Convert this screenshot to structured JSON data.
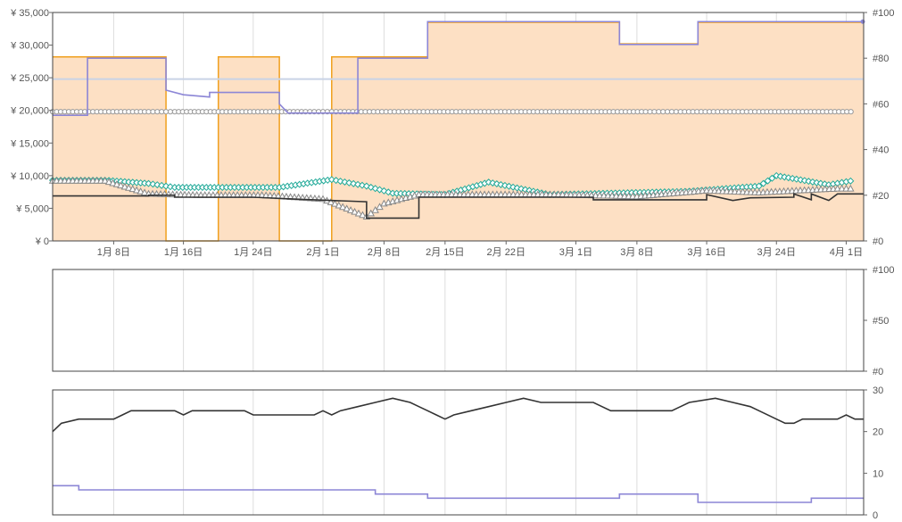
{
  "chart_data": [
    {
      "type": "line",
      "title": "",
      "x_axis": {
        "start": "2024-01-01",
        "end": "2024-04-03",
        "ticks": [
          {
            "label": "1月 8日",
            "date": "2024-01-08"
          },
          {
            "label": "1月 16日",
            "date": "2024-01-16"
          },
          {
            "label": "1月 24日",
            "date": "2024-01-24"
          },
          {
            "label": "2月 1日",
            "date": "2024-02-01"
          },
          {
            "label": "2月 8日",
            "date": "2024-02-08"
          },
          {
            "label": "2月 15日",
            "date": "2024-02-15"
          },
          {
            "label": "2月 22日",
            "date": "2024-02-22"
          },
          {
            "label": "3月 1日",
            "date": "2024-03-01"
          },
          {
            "label": "3月 8日",
            "date": "2024-03-08"
          },
          {
            "label": "3月 16日",
            "date": "2024-03-16"
          },
          {
            "label": "3月 24日",
            "date": "2024-03-24"
          },
          {
            "label": "4月 1日",
            "date": "2024-04-01"
          }
        ]
      },
      "left_axis": {
        "ylim": [
          0,
          35000
        ],
        "ticks": [
          0,
          5000,
          10000,
          15000,
          20000,
          25000,
          30000,
          35000
        ],
        "tick_labels": [
          "¥ 0",
          "¥ 5,000",
          "¥ 10,000",
          "¥ 15,000",
          "¥ 20,000",
          "¥ 25,000",
          "¥ 30,000",
          "¥ 35,000"
        ]
      },
      "right_axis": {
        "ylim": [
          0,
          100
        ],
        "ticks": [
          0,
          20,
          40,
          60,
          80,
          100
        ],
        "tick_labels": [
          "#0",
          "#20",
          "#40",
          "#60",
          "#80",
          "#100"
        ]
      },
      "reference_line": {
        "value": 24800,
        "color": "#c9d3e6"
      },
      "series": [
        {
          "kind": "area",
          "color": "#f0a01e",
          "fill": "#fde0c4",
          "points": [
            [
              "2024-01-01",
              28200
            ],
            [
              "2024-01-14",
              28200
            ],
            [
              "2024-01-14",
              0
            ],
            [
              "2024-01-20",
              0
            ],
            [
              "2024-01-20",
              28200
            ],
            [
              "2024-01-27",
              28200
            ],
            [
              "2024-01-27",
              0
            ],
            [
              "2024-02-02",
              0
            ],
            [
              "2024-02-02",
              28200
            ],
            [
              "2024-02-13",
              28200
            ],
            [
              "2024-02-13",
              33500
            ],
            [
              "2024-03-06",
              33500
            ],
            [
              "2024-03-06",
              30200
            ],
            [
              "2024-03-15",
              30200
            ],
            [
              "2024-03-15",
              33500
            ],
            [
              "2024-04-03",
              33500
            ]
          ]
        },
        {
          "kind": "line",
          "axis": "right",
          "color": "#8c86d6",
          "points": [
            [
              "2024-01-01",
              55
            ],
            [
              "2024-01-05",
              55
            ],
            [
              "2024-01-05",
              80
            ],
            [
              "2024-01-14",
              80
            ],
            [
              "2024-01-14",
              66
            ],
            [
              "2024-01-16",
              64
            ],
            [
              "2024-01-19",
              63
            ],
            [
              "2024-01-19",
              65
            ],
            [
              "2024-01-27",
              65
            ],
            [
              "2024-01-27",
              60
            ],
            [
              "2024-01-28",
              56
            ],
            [
              "2024-02-05",
              56
            ],
            [
              "2024-02-05",
              80
            ],
            [
              "2024-02-13",
              80
            ],
            [
              "2024-02-13",
              96
            ],
            [
              "2024-03-06",
              96
            ],
            [
              "2024-03-06",
              86
            ],
            [
              "2024-03-15",
              86
            ],
            [
              "2024-03-15",
              96
            ],
            [
              "2024-04-03",
              96
            ]
          ]
        },
        {
          "kind": "line",
          "color": "#333333",
          "points": [
            [
              "2024-01-01",
              6900
            ],
            [
              "2024-01-12",
              6900
            ],
            [
              "2024-01-12",
              7000
            ],
            [
              "2024-01-15",
              7000
            ],
            [
              "2024-01-15",
              6700
            ],
            [
              "2024-01-24",
              6700
            ],
            [
              "2024-01-29",
              6400
            ],
            [
              "2024-02-06",
              6000
            ],
            [
              "2024-02-06",
              3500
            ],
            [
              "2024-02-12",
              3500
            ],
            [
              "2024-02-12",
              6700
            ],
            [
              "2024-03-03",
              6700
            ],
            [
              "2024-03-03",
              6300
            ],
            [
              "2024-03-16",
              6300
            ],
            [
              "2024-03-16",
              7100
            ],
            [
              "2024-03-19",
              6200
            ],
            [
              "2024-03-21",
              6600
            ],
            [
              "2024-03-26",
              6700
            ],
            [
              "2024-03-26",
              7200
            ],
            [
              "2024-03-28",
              6300
            ],
            [
              "2024-03-28",
              7200
            ],
            [
              "2024-03-30",
              6200
            ],
            [
              "2024-03-31",
              7200
            ],
            [
              "2024-04-03",
              7200
            ]
          ]
        },
        {
          "kind": "markers",
          "shape": "circle",
          "color": "#999999",
          "points": [
            [
              "2024-01-01",
              19800
            ],
            [
              "2024-01-07",
              19800
            ],
            [
              "2024-01-12",
              19800
            ],
            [
              "2024-01-15",
              19800
            ],
            [
              "2024-01-20",
              19800
            ],
            [
              "2024-01-25",
              19800
            ],
            [
              "2024-01-30",
              19800
            ],
            [
              "2024-02-03",
              19800
            ],
            [
              "2024-02-13",
              19800
            ],
            [
              "2024-02-20",
              19800
            ],
            [
              "2024-02-27",
              19800
            ],
            [
              "2024-03-03",
              19800
            ],
            [
              "2024-03-09",
              19800
            ],
            [
              "2024-03-13",
              19800
            ],
            [
              "2024-03-22",
              19800
            ],
            [
              "2024-03-27",
              19800
            ],
            [
              "2024-04-02",
              19800
            ]
          ]
        },
        {
          "kind": "markers",
          "shape": "diamond",
          "color": "#22aa99",
          "points": [
            [
              "2024-01-01",
              9300
            ],
            [
              "2024-01-07",
              9300
            ],
            [
              "2024-01-12",
              8800
            ],
            [
              "2024-01-15",
              8200
            ],
            [
              "2024-01-20",
              8200
            ],
            [
              "2024-01-27",
              8200
            ],
            [
              "2024-02-02",
              9400
            ],
            [
              "2024-02-06",
              8400
            ],
            [
              "2024-02-09",
              7300
            ],
            [
              "2024-02-15",
              7100
            ],
            [
              "2024-02-20",
              9000
            ],
            [
              "2024-02-27",
              7100
            ],
            [
              "2024-03-14",
              7600
            ],
            [
              "2024-03-22",
              8400
            ],
            [
              "2024-03-24",
              10000
            ],
            [
              "2024-03-30",
              8600
            ],
            [
              "2024-04-02",
              9300
            ]
          ]
        },
        {
          "kind": "markers",
          "shape": "triangle",
          "color": "#888888",
          "points": [
            [
              "2024-01-01",
              9200
            ],
            [
              "2024-01-07",
              9200
            ],
            [
              "2024-01-12",
              7200
            ],
            [
              "2024-01-18",
              7000
            ],
            [
              "2024-01-25",
              7000
            ],
            [
              "2024-02-01",
              6400
            ],
            [
              "2024-02-06",
              3700
            ],
            [
              "2024-02-08",
              5700
            ],
            [
              "2024-02-12",
              7100
            ],
            [
              "2024-02-20",
              7100
            ],
            [
              "2024-02-28",
              7100
            ],
            [
              "2024-03-08",
              6800
            ],
            [
              "2024-03-16",
              7700
            ],
            [
              "2024-03-22",
              7400
            ],
            [
              "2024-03-31",
              8000
            ],
            [
              "2024-04-02",
              8000
            ]
          ]
        }
      ]
    },
    {
      "type": "line",
      "title": "",
      "right_axis": {
        "ylim": [
          0,
          100
        ],
        "ticks": [
          0,
          50,
          100
        ],
        "tick_labels": [
          "#0",
          "#50",
          "#100"
        ]
      },
      "series": []
    },
    {
      "type": "line",
      "title": "",
      "right_axis": {
        "ylim": [
          0,
          30
        ],
        "ticks": [
          0,
          10,
          20,
          30
        ],
        "tick_labels": [
          "0",
          "10",
          "20",
          "30"
        ]
      },
      "series": [
        {
          "kind": "line",
          "color": "#333333",
          "points": [
            [
              "2024-01-01",
              20
            ],
            [
              "2024-01-02",
              22
            ],
            [
              "2024-01-04",
              23
            ],
            [
              "2024-01-08",
              23
            ],
            [
              "2024-01-09",
              24
            ],
            [
              "2024-01-10",
              25
            ],
            [
              "2024-01-15",
              25
            ],
            [
              "2024-01-16",
              24
            ],
            [
              "2024-01-17",
              25
            ],
            [
              "2024-01-23",
              25
            ],
            [
              "2024-01-24",
              24
            ],
            [
              "2024-01-31",
              24
            ],
            [
              "2024-02-01",
              25
            ],
            [
              "2024-02-02",
              24
            ],
            [
              "2024-02-03",
              25
            ],
            [
              "2024-02-05",
              26
            ],
            [
              "2024-02-07",
              27
            ],
            [
              "2024-02-09",
              28
            ],
            [
              "2024-02-11",
              27
            ],
            [
              "2024-02-12",
              26
            ],
            [
              "2024-02-13",
              25
            ],
            [
              "2024-02-14",
              24
            ],
            [
              "2024-02-15",
              23
            ],
            [
              "2024-02-16",
              24
            ],
            [
              "2024-02-18",
              25
            ],
            [
              "2024-02-20",
              26
            ],
            [
              "2024-02-22",
              27
            ],
            [
              "2024-02-24",
              28
            ],
            [
              "2024-02-26",
              27
            ],
            [
              "2024-03-03",
              27
            ],
            [
              "2024-03-04",
              26
            ],
            [
              "2024-03-05",
              25
            ],
            [
              "2024-03-12",
              25
            ],
            [
              "2024-03-13",
              26
            ],
            [
              "2024-03-14",
              27
            ],
            [
              "2024-03-17",
              28
            ],
            [
              "2024-03-19",
              27
            ],
            [
              "2024-03-21",
              26
            ],
            [
              "2024-03-22",
              25
            ],
            [
              "2024-03-24",
              23
            ],
            [
              "2024-03-25",
              22
            ],
            [
              "2024-03-26",
              22
            ],
            [
              "2024-03-27",
              23
            ],
            [
              "2024-03-31",
              23
            ],
            [
              "2024-04-01",
              24
            ],
            [
              "2024-04-02",
              23
            ],
            [
              "2024-04-03",
              23
            ]
          ]
        },
        {
          "kind": "line",
          "color": "#8c86d6",
          "points": [
            [
              "2024-01-01",
              7
            ],
            [
              "2024-01-04",
              7
            ],
            [
              "2024-01-04",
              6
            ],
            [
              "2024-02-07",
              6
            ],
            [
              "2024-02-07",
              5
            ],
            [
              "2024-02-13",
              5
            ],
            [
              "2024-02-13",
              4
            ],
            [
              "2024-03-06",
              4
            ],
            [
              "2024-03-06",
              5
            ],
            [
              "2024-03-15",
              5
            ],
            [
              "2024-03-15",
              3
            ],
            [
              "2024-03-28",
              3
            ],
            [
              "2024-03-28",
              4
            ],
            [
              "2024-04-03",
              4
            ]
          ]
        }
      ]
    }
  ]
}
